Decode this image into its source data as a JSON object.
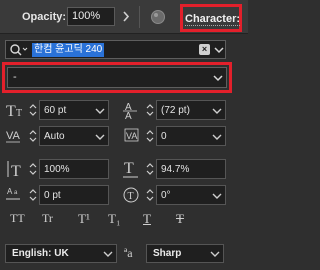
{
  "top": {
    "opacity_label": "Opacity:",
    "opacity_value": "100%",
    "character_tab": "Character:"
  },
  "font": {
    "family": "한컴 윤고딕 240",
    "style": "-"
  },
  "metrics": {
    "font_size": "60 pt",
    "leading": "(72 pt)",
    "kerning": "Auto",
    "tracking": "0",
    "vertical_scale": "100%",
    "horizontal_scale": "94.7%",
    "baseline_shift": "0 pt",
    "rotation": "0°"
  },
  "glyph_buttons": [
    "TT",
    "Tr",
    "T¹",
    "T₁",
    "T",
    "T"
  ],
  "bottom": {
    "language": "English: UK",
    "aa_icon": "ªa",
    "antialias": "Sharp"
  },
  "colors": {
    "highlight_red": "#e3202b",
    "selection_blue": "#2a72d8"
  }
}
